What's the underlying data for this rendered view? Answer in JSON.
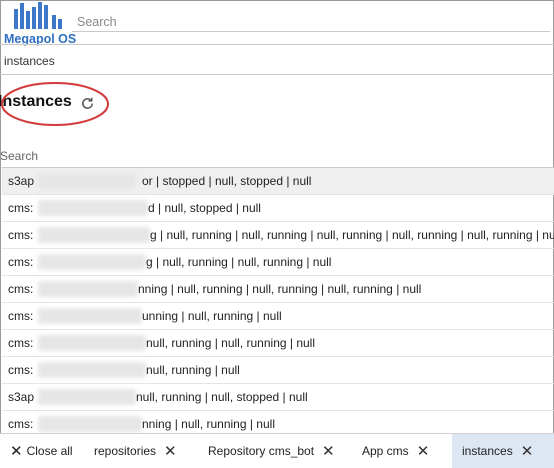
{
  "app": {
    "brand": "Megapol OS"
  },
  "search": {
    "placeholder": "Search"
  },
  "breadcrumb": "instances",
  "page": {
    "title": "Instances",
    "list_search_label": "Search"
  },
  "instances": [
    {
      "prefix": "s3ap",
      "suffix": "or | stopped | null, stopped | null"
    },
    {
      "prefix": "cms:",
      "suffix": "d | null, stopped | null"
    },
    {
      "prefix": "cms:",
      "suffix": "g | null, running | null, running | null, running | null, running | null, running | null, running | null, ru"
    },
    {
      "prefix": "cms:",
      "suffix": "g | null, running | null, running | null"
    },
    {
      "prefix": "cms:",
      "suffix": "nning | null, running | null, running | null, running | null"
    },
    {
      "prefix": "cms:",
      "suffix": "unning | null, running | null"
    },
    {
      "prefix": "cms:",
      "suffix": " null, running | null, running | null"
    },
    {
      "prefix": "cms:",
      "suffix": " null, running | null"
    },
    {
      "prefix": "s3ap",
      "suffix": "null, running | null, stopped | null"
    },
    {
      "prefix": "cms:",
      "suffix": "nning | null, running | null"
    }
  ],
  "tabs": {
    "close_all": "Close all",
    "items": [
      {
        "label": "repositories",
        "active": false
      },
      {
        "label": "Repository cms_bot",
        "active": false
      },
      {
        "label": "App cms",
        "active": false
      },
      {
        "label": "instances",
        "active": true
      }
    ]
  },
  "icons": {
    "refresh": "refresh-icon",
    "close": "close-icon",
    "logo": "building-logo-icon"
  },
  "colors": {
    "brand": "#2f6fc0",
    "annotation": "#d23a3a",
    "active_tab": "#dde6f3"
  }
}
